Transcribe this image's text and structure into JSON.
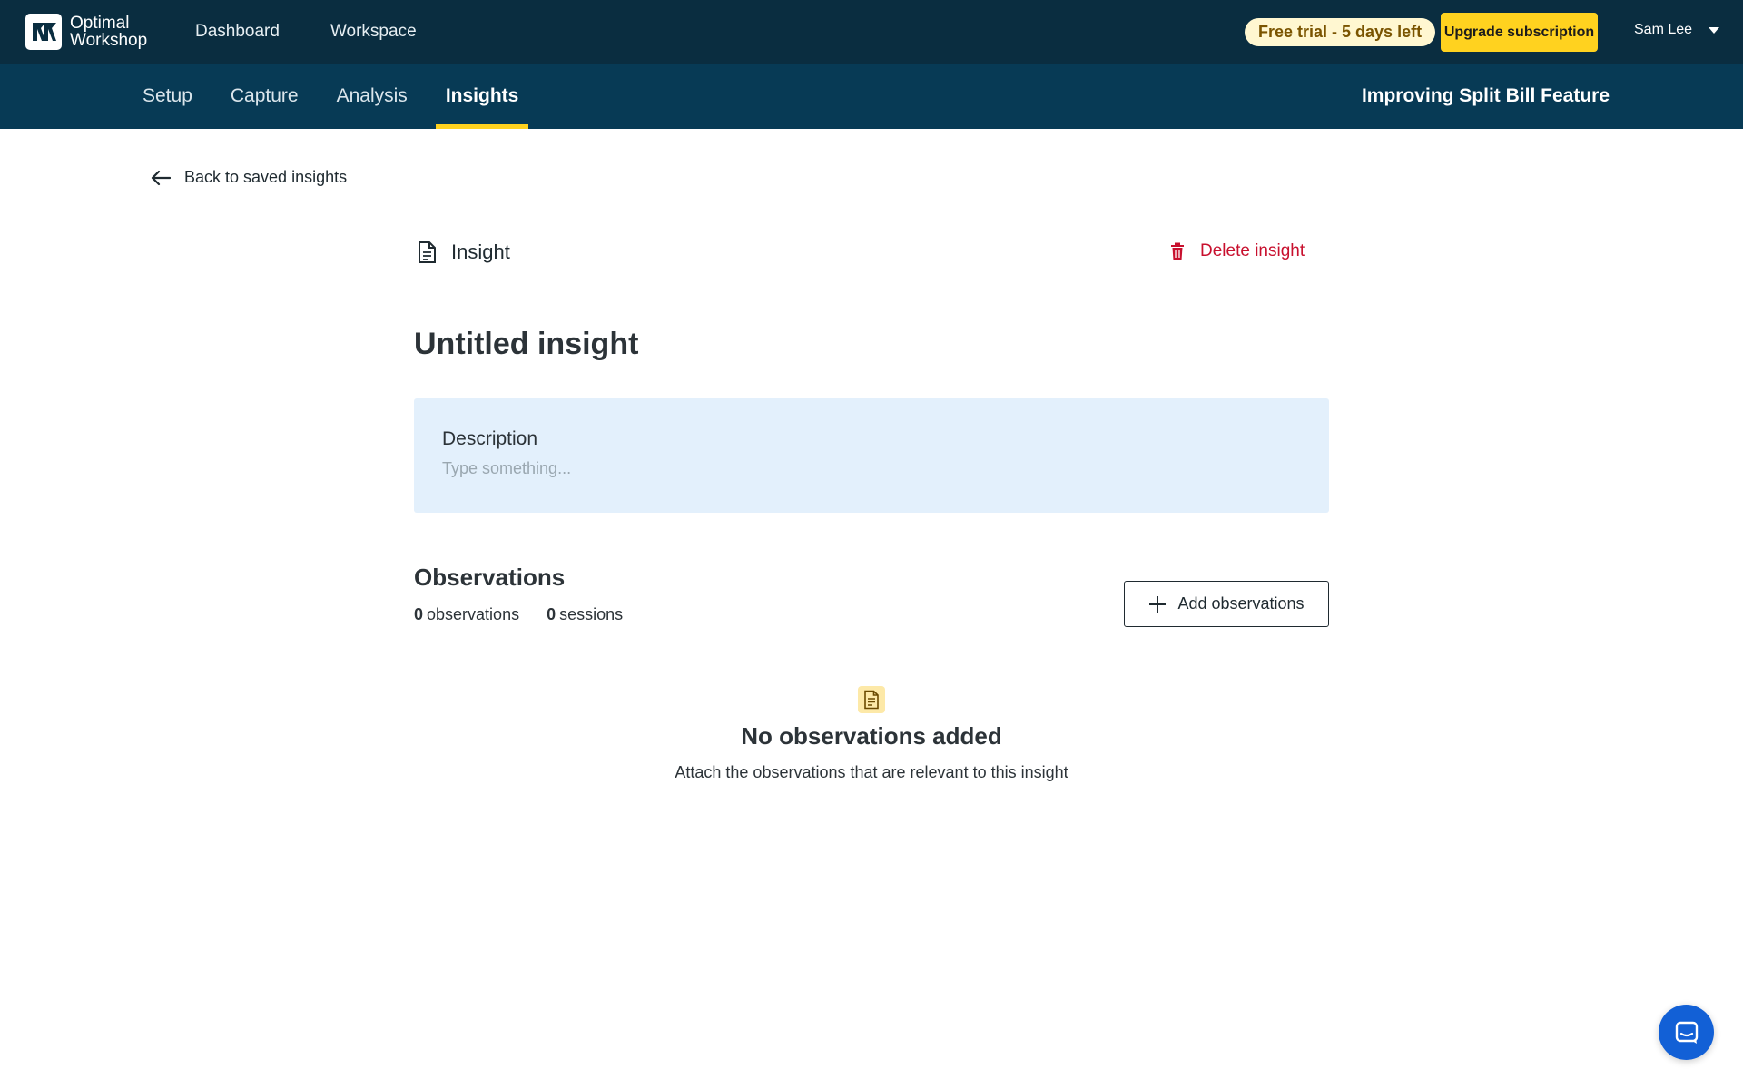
{
  "app": {
    "logo_line1": "Optimal",
    "logo_line2": "Workshop"
  },
  "topnav": {
    "dashboard": "Dashboard",
    "workspace": "Workspace",
    "trial_badge": "Free trial - 5 days left",
    "upgrade_label": "Upgrade subscription",
    "user_name": "Sam Lee"
  },
  "subnav": {
    "tabs": [
      {
        "label": "Setup"
      },
      {
        "label": "Capture"
      },
      {
        "label": "Analysis"
      },
      {
        "label": "Insights",
        "active": true
      }
    ],
    "project_title": "Improving Split Bill Feature"
  },
  "page": {
    "back_label": "Back to saved insights",
    "section_label": "Insight",
    "delete_label": "Delete insight",
    "title": "Untitled insight",
    "description": {
      "label": "Description",
      "placeholder": "Type something...",
      "value": ""
    },
    "observations": {
      "heading": "Observations",
      "observation_count": "0",
      "observation_unit": "observations",
      "session_count": "0",
      "session_unit": "sessions",
      "add_label": "Add observations"
    },
    "empty_state": {
      "title": "No observations added",
      "subtitle": "Attach the observations that are relevant to this insight"
    }
  },
  "colors": {
    "topbar": "#0a2d40",
    "subnav": "#073a55",
    "accent_yellow": "#ffd21f",
    "danger": "#c8102e",
    "description_bg": "#e3f0fc",
    "chat_blue": "#1260d6"
  },
  "icons": {
    "back": "arrow-left-icon",
    "insight": "document-icon",
    "delete": "trash-icon",
    "add": "plus-icon",
    "empty": "document-icon",
    "chat": "chat-icon",
    "user_caret": "chevron-down-icon"
  }
}
